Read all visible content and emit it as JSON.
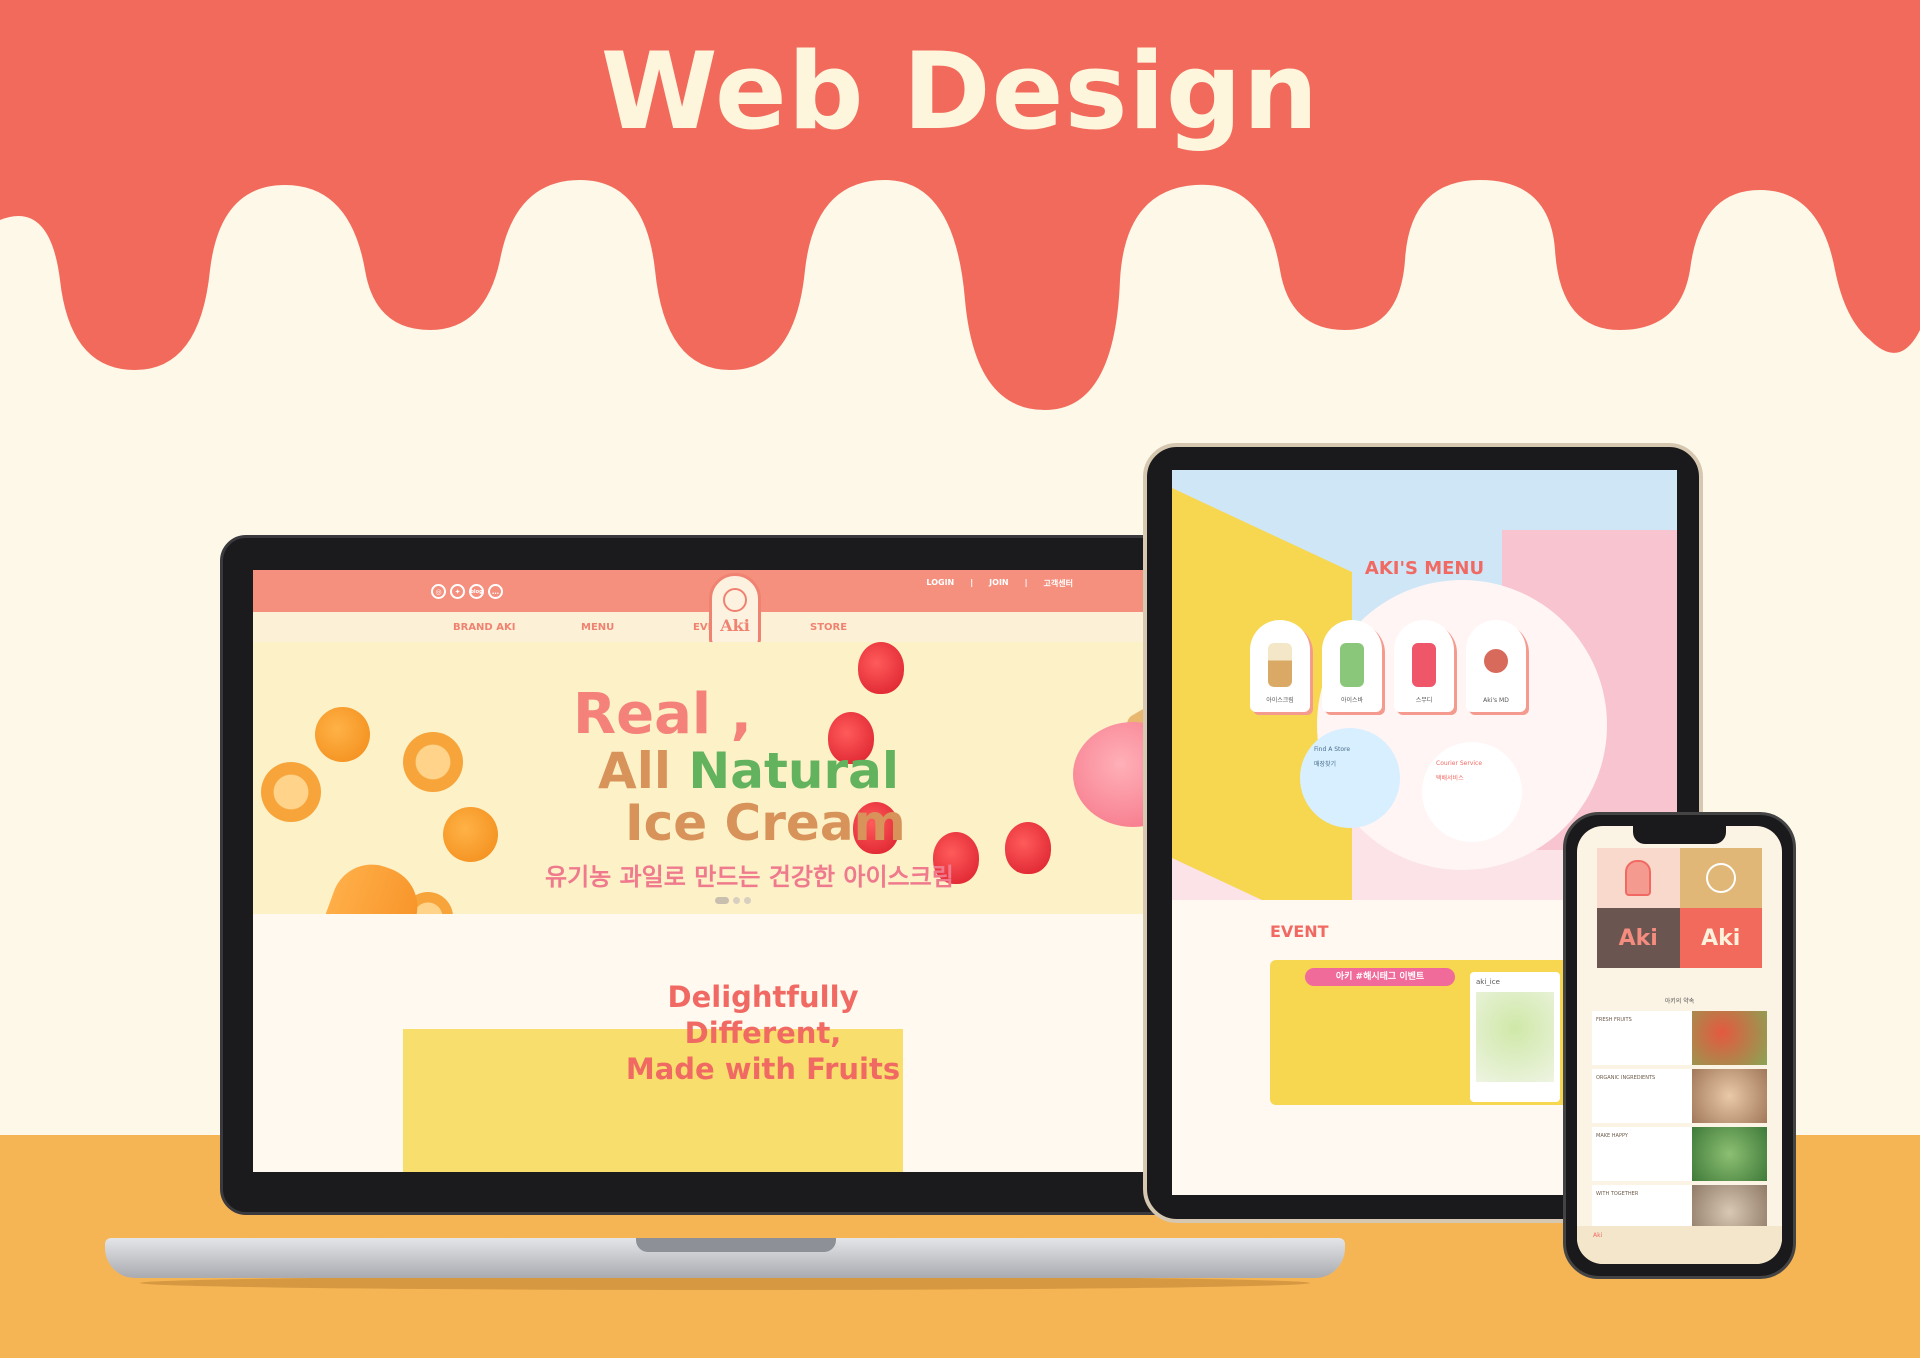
{
  "banner": {
    "title": "Web Design"
  },
  "colors": {
    "coral": "#f26a5c",
    "cream": "#fdf8e8",
    "floor": "#f6b555",
    "accent_green": "#63b35e"
  },
  "laptop": {
    "social_icons": [
      "instagram-icon",
      "twitter-icon",
      "blog-icon",
      "talk-icon"
    ],
    "social_labels": {
      "blog": "blog"
    },
    "header_links": [
      "LOGIN",
      "JOIN",
      "고객센터"
    ],
    "nav": [
      "BRAND AKI",
      "MENU",
      "EVENT",
      "STORE"
    ],
    "logo_text": "Aki",
    "hero": {
      "line1": "Real ,",
      "line2_a": "All ",
      "line2_b": "Natural",
      "line3": "Ice Cream",
      "subtitle": "유기농 과일로 만드는 건강한 아이스크림"
    },
    "section2": {
      "line1": "Delightfully",
      "line2": "Different,",
      "line3": "Made with Fruits"
    }
  },
  "tablet": {
    "menu_title": "AKI'S MENU",
    "menu_items": [
      "아이스크림",
      "아이스바",
      "스무디",
      "Aki's MD"
    ],
    "store_bubble": {
      "title": "Find A Store",
      "label": "매장찾기"
    },
    "courier_bubble": {
      "title": "Courier Service",
      "label": "택배서비스"
    },
    "event_title": "EVENT",
    "event_tag": "아키 #해시태그 이벤트",
    "insta_handle": "aki_ice"
  },
  "phone": {
    "logo_cells": [
      "Aki",
      "Aki"
    ],
    "promise_title": "아키의 약속",
    "rows": [
      "FRESH FRUITS",
      "ORGANIC INGREDIENTS",
      "MAKE HAPPY",
      "WITH TOGETHER"
    ],
    "footer_logo": "Aki"
  }
}
